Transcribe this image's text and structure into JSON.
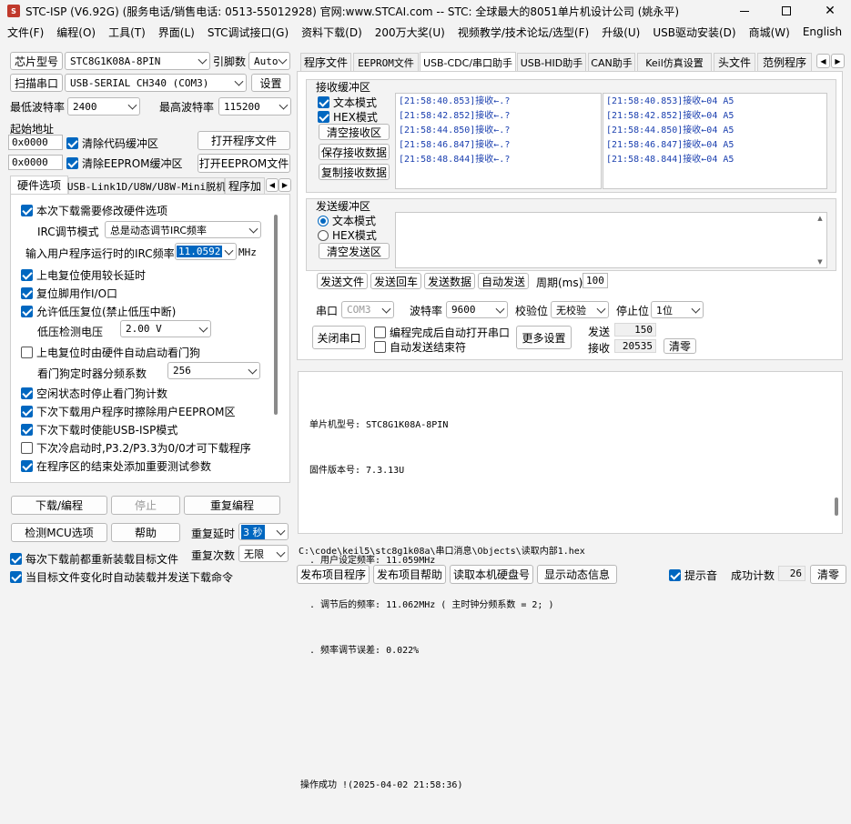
{
  "window": {
    "title": "STC-ISP (V6.92G) (服务电话/销售电话: 0513-55012928) 官网:www.STCAI.com  -- STC: 全球最大的8051单片机设计公司 (姚永平)",
    "icon": "stc-app-icon"
  },
  "menu": [
    "文件(F)",
    "编程(O)",
    "工具(T)",
    "界面(L)",
    "STC调试接口(G)",
    "资料下载(D)",
    "200万大奖(U)",
    "视频教学/技术论坛/选型(F)",
    "升级(U)",
    "USB驱动安装(D)",
    "商城(W)",
    "English"
  ],
  "left": {
    "chip_label": "芯片型号",
    "chip_value": "STC8G1K08A-8PIN",
    "pin_label": "引脚数",
    "pin_value": "Auto",
    "scan_label": "扫描串口",
    "port_value": "USB-SERIAL CH340 (COM3)",
    "settings_label": "设置",
    "min_baud_label": "最低波特率",
    "min_baud_value": "2400",
    "max_baud_label": "最高波特率",
    "max_baud_value": "115200",
    "start_addr_label": "起始地址",
    "addr1": "0x0000",
    "clear_code_label": "清除代码缓冲区",
    "open_prog_label": "打开程序文件",
    "addr2": "0x0000",
    "clear_eeprom_label": "清除EEPROM缓冲区",
    "open_eeprom_label": "打开EEPROM文件",
    "tabs": [
      "硬件选项",
      "USB-Link1D/U8W/U8W-Mini脱机",
      "程序加"
    ],
    "hw": {
      "opt_modify": "本次下载需要修改硬件选项",
      "irc_mode_label": "IRC调节模式",
      "irc_mode_value": "总是动态调节IRC频率",
      "irc_freq_label": "输入用户程序运行时的IRC频率",
      "irc_freq_value": "11.0592",
      "irc_unit": "MHz",
      "opt1": "上电复位使用较长延时",
      "opt2": "复位脚用作I/O口",
      "opt3": "允许低压复位(禁止低压中断)",
      "lvd_label": "低压检测电压",
      "lvd_value": "2.00 V",
      "opt4": "上电复位时由硬件自动启动看门狗",
      "wdt_label": "看门狗定时器分频系数",
      "wdt_value": "256",
      "opt5": "空闲状态时停止看门狗计数",
      "opt6": "下次下载用户程序时擦除用户EEPROM区",
      "opt7": "下次下载时使能USB-ISP模式",
      "opt8": "下次冷启动时,P3.2/P3.3为0/0才可下载程序",
      "opt9": "在程序区的结束处添加重要测试参数"
    },
    "download_label": "下载/编程",
    "stop_label": "停止",
    "reprogram_label": "重复编程",
    "check_mcu_label": "检测MCU选项",
    "help_label": "帮助",
    "repeat_delay_label": "重复延时",
    "repeat_delay_value": "3 秒",
    "repeat_count_label": "重复次数",
    "repeat_count_value": "无限",
    "reload_label": "每次下载前都重新装载目标文件",
    "autosend_label": "当目标文件变化时自动装载并发送下载命令"
  },
  "right": {
    "tabs": [
      "程序文件",
      "EEPROM文件",
      "USB-CDC/串口助手",
      "USB-HID助手",
      "CAN助手",
      "Keil仿真设置",
      "头文件",
      "范例程序"
    ],
    "recv": {
      "title": "接收缓冲区",
      "text_mode": "文本模式",
      "hex_mode": "HEX模式",
      "clear": "清空接收区",
      "save": "保存接收数据",
      "copy": "复制接收数据",
      "text_lines": [
        "[21:58:40.853]接收←.?",
        "[21:58:42.852]接收←.?",
        "[21:58:44.850]接收←.?",
        "[21:58:46.847]接收←.?",
        "[21:58:48.844]接收←.?"
      ],
      "hex_lines": [
        "[21:58:40.853]接收←04 A5",
        "[21:58:42.852]接收←04 A5",
        "[21:58:44.850]接收←04 A5",
        "[21:58:46.847]接收←04 A5",
        "[21:58:48.844]接收←04 A5"
      ]
    },
    "send": {
      "title": "发送缓冲区",
      "text_mode": "文本模式",
      "hex_mode": "HEX模式",
      "clear": "清空发送区",
      "send_file": "发送文件",
      "send_cr": "发送回车",
      "send_data": "发送数据",
      "auto_send": "自动发送",
      "period_label": "周期(ms)",
      "period_value": "100"
    },
    "serial": {
      "port_label": "串口",
      "port_value": "COM3",
      "baud_label": "波特率",
      "baud_value": "9600",
      "parity_label": "校验位",
      "parity_value": "无校验",
      "stop_label": "停止位",
      "stop_value": "1位",
      "close_label": "关闭串口",
      "auto_open_label": "编程完成后自动打开串口",
      "auto_end_label": "自动发送结束符",
      "more_label": "更多设置",
      "sent_label": "发送",
      "sent_value": "150",
      "recv_label": "接收",
      "recv_value": "20535",
      "clear_label": "清零"
    },
    "output": [
      "单片机型号: STC8G1K08A-8PIN",
      "固件版本号: 7.3.13U",
      "",
      ". 用户设定频率: 11.059MHz",
      ". 调节后的频率: 11.062MHz ( 主时钟分频系数 = 2; )",
      ". 频率调节误差: 0.022%",
      "",
      "",
      "",
      "操作成功 !(2025-04-02 21:58:36)"
    ],
    "path": "C:\\code\\keil5\\stc8g1k08a\\串口消息\\Objects\\读取内部1.hex",
    "bottom": {
      "publish_prog": "发布项目程序",
      "publish_help": "发布项目帮助",
      "read_disk": "读取本机硬盘号",
      "show_dynamic": "显示动态信息",
      "beep_label": "提示音",
      "success_label": "成功计数",
      "success_value": "26",
      "clear_label": "清零"
    }
  }
}
